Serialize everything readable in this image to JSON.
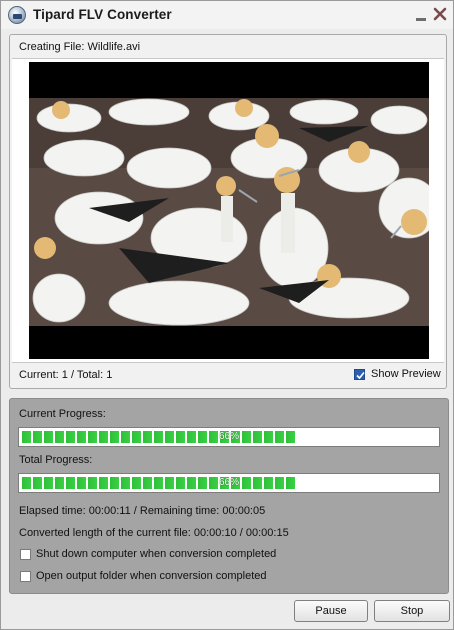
{
  "window": {
    "title": "Tipard FLV Converter"
  },
  "preview_panel": {
    "creating_file": "Creating File: Wildlife.avi",
    "counter": "Current: 1 / Total: 1",
    "show_preview_label": "Show Preview",
    "show_preview_checked": true
  },
  "progress_panel": {
    "current_label": "Current Progress:",
    "current_percent_text": "66%",
    "current_value": 0.66,
    "total_label": "Total Progress:",
    "total_percent_text": "66%",
    "total_value": 0.66,
    "time_text": "Elapsed time: 00:00:11 / Remaining time: 00:00:05",
    "length_text": "Converted length of the current file: 00:00:10 / 00:00:15",
    "options": [
      {
        "label": "Shut down computer when conversion completed",
        "checked": false
      },
      {
        "label": "Open output folder when conversion completed",
        "checked": false
      }
    ]
  },
  "buttons": {
    "pause": "Pause",
    "stop": "Stop"
  },
  "colors": {
    "progress_fill": "#35c940",
    "accent_checkbox": "#2b5fb0",
    "panel_gray": "#a4a4a4"
  },
  "icons": {
    "app": "flv-app-icon",
    "minimize": "minimize-icon",
    "close": "close-icon"
  }
}
